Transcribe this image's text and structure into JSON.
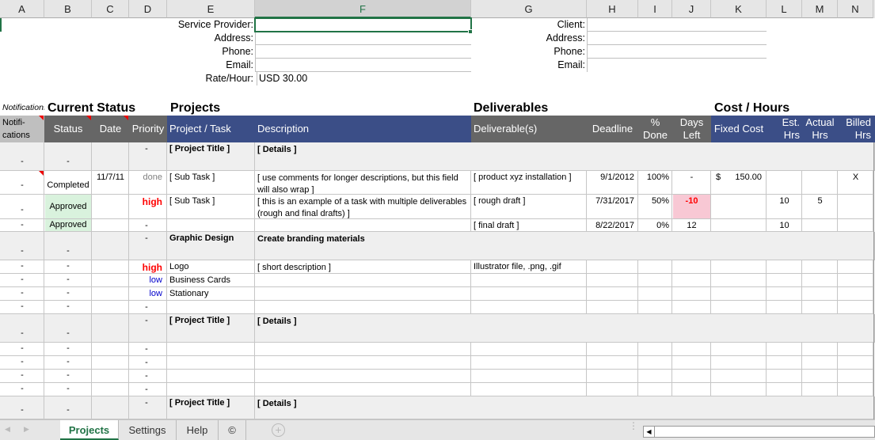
{
  "columns": [
    "A",
    "B",
    "C",
    "D",
    "E",
    "F",
    "G",
    "H",
    "I",
    "J",
    "K",
    "L",
    "M",
    "N"
  ],
  "selected_column": "F",
  "provider": {
    "labels": [
      "Service Provider:",
      "Address:",
      "Phone:",
      "Email:",
      "Rate/Hour:"
    ],
    "rate_value": "USD 30.00"
  },
  "client": {
    "labels": [
      "Client:",
      "Address:",
      "Phone:",
      "Email:"
    ]
  },
  "sections": {
    "notifications": "Notifications",
    "current_status": "Current Status",
    "projects": "Projects",
    "deliverables": "Deliverables",
    "cost_hours": "Cost / Hours"
  },
  "headers": {
    "notifications": "Notifi-\ncations",
    "status": "Status",
    "date": "Date",
    "priority": "Priority",
    "project_task": "Project / Task",
    "description": "Description",
    "deliverables": "Deliverable(s)",
    "deadline": "Deadline",
    "pct_done": "%\nDone",
    "days_left": "Days\nLeft",
    "fixed_cost": "Fixed Cost",
    "est_hrs": "Est.\nHrs",
    "actual_hrs": "Actual\nHrs",
    "billed_hrs": "Billed\nHrs"
  },
  "rows": [
    {
      "type": "project",
      "notif": "-",
      "status": "-",
      "date": "",
      "priority": "-",
      "task": "[ Project Title ]",
      "desc": "[ Details ]"
    },
    {
      "type": "task",
      "notif": "-",
      "status": "Completed",
      "date": "11/7/11",
      "priority": "done",
      "task": "[ Sub Task ]",
      "desc": "[ use comments for longer descriptions, but this field\nwill also wrap ]",
      "deliv": "[ product xyz installation ]",
      "deadline": "9/1/2012",
      "pct": "100%",
      "days": "-",
      "cost_sym": "$",
      "cost": "150.00",
      "est": "",
      "actual": "",
      "billed": "X"
    },
    {
      "type": "task",
      "notif": "-",
      "status": "Approved",
      "date": "",
      "priority": "high",
      "task": "[ Sub Task ]",
      "desc": "[ this is an example of a task with multiple deliverables\n(rough and final drafts) ]",
      "deliv": "[ rough draft ]",
      "deadline": "7/31/2017",
      "pct": "50%",
      "days": "-10",
      "cost_sym": "",
      "cost": "",
      "est": "10",
      "actual": "5",
      "billed": ""
    },
    {
      "type": "task",
      "notif": "-",
      "status": "Approved",
      "date": "",
      "priority": "-",
      "task": "",
      "desc": "",
      "deliv": "[ final draft ]",
      "deadline": "8/22/2017",
      "pct": "0%",
      "days": "12",
      "cost_sym": "",
      "cost": "",
      "est": "10",
      "actual": "",
      "billed": ""
    },
    {
      "type": "project",
      "notif": "-",
      "status": "-",
      "date": "",
      "priority": "-",
      "task": "Graphic Design",
      "desc": "Create branding materials"
    },
    {
      "type": "task",
      "notif": "-",
      "status": "-",
      "date": "",
      "priority": "high",
      "task": "Logo",
      "desc": "[ short description ]",
      "deliv": "Illustrator file, .png, .gif",
      "deadline": "",
      "pct": "",
      "days": "",
      "cost_sym": "",
      "cost": "",
      "est": "",
      "actual": "",
      "billed": ""
    },
    {
      "type": "task",
      "notif": "-",
      "status": "-",
      "date": "",
      "priority": "low",
      "task": "Business Cards",
      "desc": "",
      "deliv": "",
      "deadline": "",
      "pct": "",
      "days": "",
      "cost_sym": "",
      "cost": "",
      "est": "",
      "actual": "",
      "billed": ""
    },
    {
      "type": "task",
      "notif": "-",
      "status": "-",
      "date": "",
      "priority": "low",
      "task": "Stationary",
      "desc": "",
      "deliv": "",
      "deadline": "",
      "pct": "",
      "days": "",
      "cost_sym": "",
      "cost": "",
      "est": "",
      "actual": "",
      "billed": ""
    },
    {
      "type": "task",
      "notif": "-",
      "status": "-",
      "date": "",
      "priority": "-",
      "task": "",
      "desc": "",
      "deliv": "",
      "deadline": "",
      "pct": "",
      "days": "",
      "cost_sym": "",
      "cost": "",
      "est": "",
      "actual": "",
      "billed": ""
    },
    {
      "type": "project",
      "notif": "-",
      "status": "-",
      "date": "",
      "priority": "-",
      "task": "[ Project Title ]",
      "desc": "[ Details ]"
    },
    {
      "type": "task",
      "notif": "-",
      "status": "-",
      "date": "",
      "priority": "-",
      "task": "",
      "desc": "",
      "deliv": "",
      "deadline": "",
      "pct": "",
      "days": "",
      "cost_sym": "",
      "cost": "",
      "est": "",
      "actual": "",
      "billed": ""
    },
    {
      "type": "task",
      "notif": "-",
      "status": "-",
      "date": "",
      "priority": "-",
      "task": "",
      "desc": "",
      "deliv": "",
      "deadline": "",
      "pct": "",
      "days": "",
      "cost_sym": "",
      "cost": "",
      "est": "",
      "actual": "",
      "billed": ""
    },
    {
      "type": "task",
      "notif": "-",
      "status": "-",
      "date": "",
      "priority": "-",
      "task": "",
      "desc": "",
      "deliv": "",
      "deadline": "",
      "pct": "",
      "days": "",
      "cost_sym": "",
      "cost": "",
      "est": "",
      "actual": "",
      "billed": ""
    },
    {
      "type": "task",
      "notif": "-",
      "status": "-",
      "date": "",
      "priority": "-",
      "task": "",
      "desc": "",
      "deliv": "",
      "deadline": "",
      "pct": "",
      "days": "",
      "cost_sym": "",
      "cost": "",
      "est": "",
      "actual": "",
      "billed": ""
    },
    {
      "type": "project",
      "notif": "-",
      "status": "-",
      "date": "",
      "priority": "-",
      "task": "[ Project Title ]",
      "desc": "[ Details ]"
    }
  ],
  "colors": {
    "accent": "#217346",
    "header_grey": "#666666",
    "header_blue": "#3b4e87",
    "approved_bg": "#d9f2dd",
    "overdue_bg": "#f8c8d4",
    "overdue_text": "#ff0000",
    "high_text": "#ff0000",
    "low_text": "#0000cc",
    "done_text": "#808080"
  },
  "tabs": {
    "items": [
      "Projects",
      "Settings",
      "Help",
      "©"
    ],
    "active": "Projects",
    "add_icon": "plus-circle-icon"
  }
}
